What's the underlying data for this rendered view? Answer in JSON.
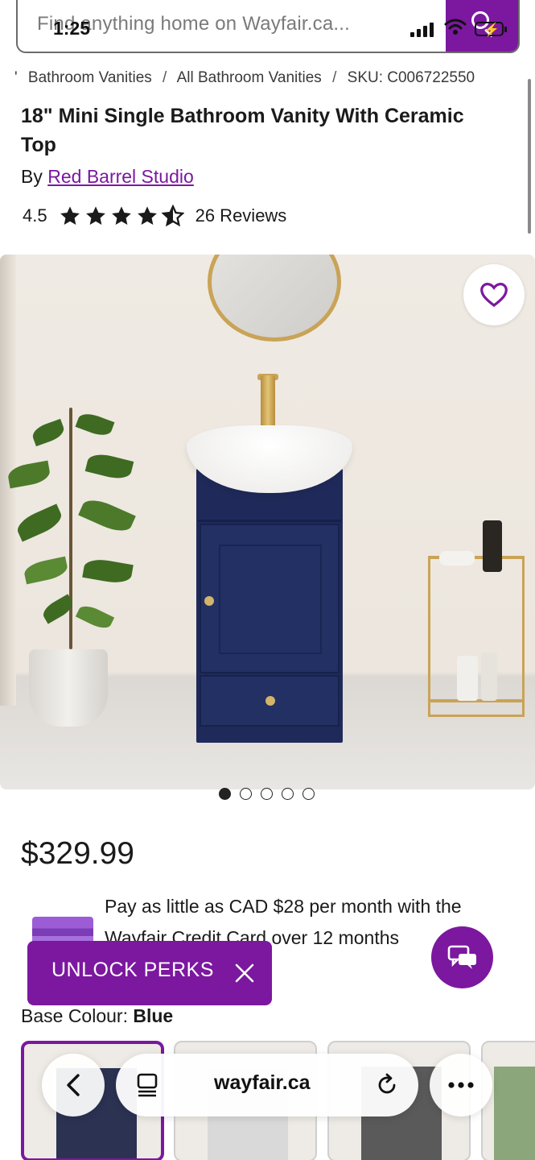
{
  "status_bar": {
    "time": "1:25"
  },
  "search": {
    "placeholder": "Find anything home on Wayfair.ca..."
  },
  "breadcrumb": {
    "lead": "'",
    "items": [
      "Bathroom Vanities",
      "All Bathroom Vanities",
      "SKU: C006722550"
    ],
    "separator": "/"
  },
  "product": {
    "title": "18\" Mini Single Bathroom Vanity With Ceramic Top",
    "by_label": "By",
    "brand": "Red Barrel Studio",
    "rating": "4.5",
    "rating_value": 4.5,
    "rating_max": 5,
    "reviews_link": "26 Reviews",
    "price": "$329.99",
    "credit_offer": "Pay as little as CAD $28 per month with the Wayfair Credit Card over 12 months",
    "base_colour_label": "Base Colour:",
    "base_colour_value": "Blue"
  },
  "carousel": {
    "count": 5,
    "active_index": 0
  },
  "perks": {
    "label": "UNLOCK PERKS"
  },
  "browser": {
    "url": "wayfair.ca"
  },
  "colors": {
    "brand": "#7b189f",
    "cabinet": "#1f2a5a",
    "gold": "#c9a357"
  },
  "icons": [
    "search-icon",
    "heart-icon",
    "star-icon",
    "chat-icon",
    "close-icon",
    "back-icon",
    "reader-icon",
    "reload-icon",
    "more-icon"
  ]
}
